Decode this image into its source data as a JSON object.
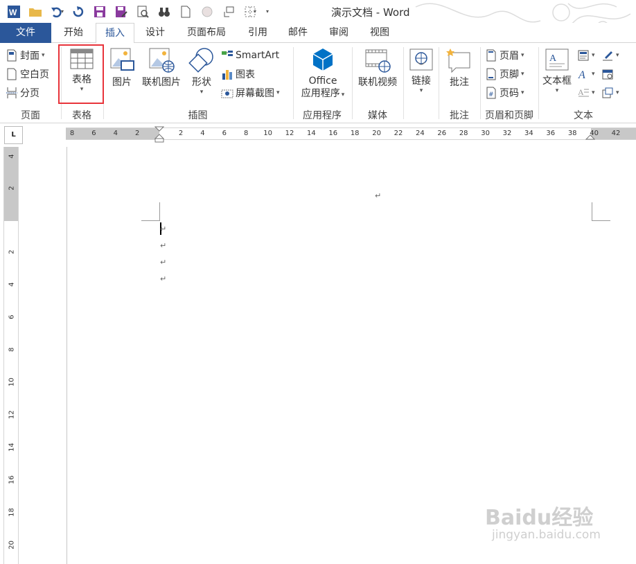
{
  "title_bar": {
    "title": "演示文档 - Word"
  },
  "tabs": [
    "文件",
    "开始",
    "插入",
    "设计",
    "页面布局",
    "引用",
    "邮件",
    "审阅",
    "视图"
  ],
  "ribbon": {
    "pages": {
      "cover": "封面",
      "blank": "空白页",
      "break": "分页",
      "label": "页面"
    },
    "tables": {
      "table": "表格",
      "label": "表格"
    },
    "illustrations": {
      "picture": "图片",
      "online_picture": "联机图片",
      "shapes": "形状",
      "smartart": "SmartArt",
      "chart": "图表",
      "screenshot": "屏幕截图",
      "label": "插图"
    },
    "apps": {
      "office_line1": "Office",
      "office_line2": "应用程序",
      "label": "应用程序"
    },
    "media": {
      "online_video": "联机视频",
      "label": "媒体"
    },
    "links": {
      "link": "链接"
    },
    "comments": {
      "comment": "批注",
      "label": "批注"
    },
    "header_footer": {
      "header": "页眉",
      "footer": "页脚",
      "page_number": "页码",
      "label": "页眉和页脚"
    },
    "text": {
      "textbox": "文本框",
      "label": "文本"
    }
  },
  "ruler": {
    "h_ticks": [
      "8",
      "6",
      "4",
      "2",
      "2",
      "4",
      "6",
      "8",
      "10",
      "12",
      "14",
      "16",
      "18",
      "20",
      "22",
      "24",
      "26",
      "28",
      "30",
      "32",
      "34",
      "36",
      "38",
      "40",
      "42"
    ],
    "v_ticks": [
      "4",
      "2",
      "2",
      "4",
      "6",
      "8",
      "10",
      "12",
      "14",
      "16",
      "18",
      "20"
    ],
    "tab_selector": "L"
  },
  "watermark": {
    "main": "Baidu经验",
    "sub": "jingyan.baidu.com"
  },
  "colors": {
    "accent": "#2b579a",
    "highlight": "#e8333a"
  }
}
